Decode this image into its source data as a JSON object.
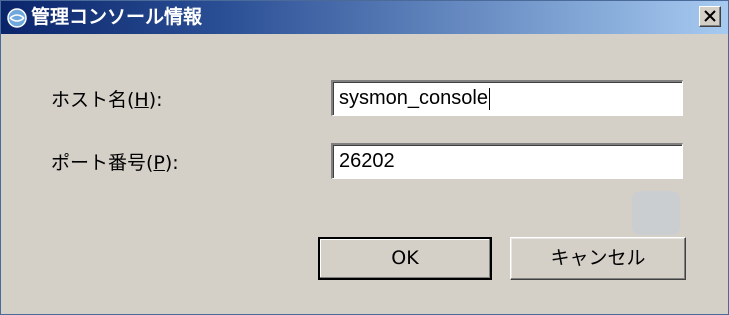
{
  "window": {
    "title": "管理コンソール情報",
    "title_icon": "globe-icon",
    "close_icon": "close-icon"
  },
  "form": {
    "host": {
      "label_prefix": "ホスト名(",
      "mnemonic": "H",
      "label_suffix": "):",
      "value": "sysmon_console"
    },
    "port": {
      "label_prefix": "ポート番号(",
      "mnemonic": "P",
      "label_suffix": "):",
      "value": "26202"
    }
  },
  "buttons": {
    "ok": "OK",
    "cancel": "キャンセル"
  },
  "colors": {
    "titlebar_start": "#0a246a",
    "titlebar_end": "#a6caf0",
    "dialog_face": "#d4d0c8"
  }
}
